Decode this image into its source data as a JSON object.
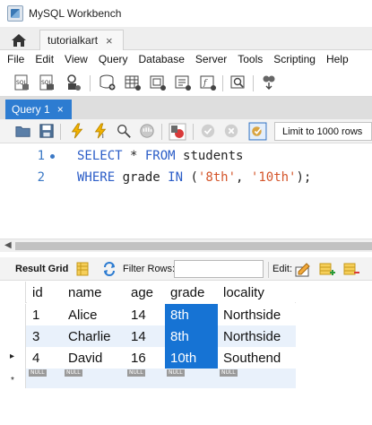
{
  "window": {
    "title": "MySQL Workbench"
  },
  "tabs": {
    "connection": "tutorialkart",
    "close_glyph": "×"
  },
  "menu": [
    "File",
    "Edit",
    "View",
    "Query",
    "Database",
    "Server",
    "Tools",
    "Scripting",
    "Help"
  ],
  "query_tab": {
    "label": "Query 1",
    "close_glyph": "×"
  },
  "sql_toolbar": {
    "limit": "Limit to 1000 rows"
  },
  "editor": {
    "lines": [
      {
        "no": "1",
        "tokens": [
          {
            "t": "kw",
            "v": "SELECT"
          },
          {
            "t": "plain",
            "v": " * "
          },
          {
            "t": "kw",
            "v": "FROM"
          },
          {
            "t": "plain",
            "v": " students"
          }
        ]
      },
      {
        "no": "2",
        "tokens": [
          {
            "t": "kw",
            "v": "WHERE"
          },
          {
            "t": "plain",
            "v": " grade "
          },
          {
            "t": "kw",
            "v": "IN"
          },
          {
            "t": "plain",
            "v": " ("
          },
          {
            "t": "str",
            "v": "'8th'"
          },
          {
            "t": "plain",
            "v": ", "
          },
          {
            "t": "str",
            "v": "'10th'"
          },
          {
            "t": "plain",
            "v": ");"
          }
        ]
      }
    ]
  },
  "result_toolbar": {
    "result_grid": "Result Grid",
    "filter_rows": "Filter Rows:",
    "edit": "Edit:"
  },
  "grid": {
    "columns": [
      "id",
      "name",
      "age",
      "grade",
      "locality"
    ],
    "rows": [
      [
        "1",
        "Alice",
        "14",
        "8th",
        "Northside"
      ],
      [
        "3",
        "Charlie",
        "14",
        "8th",
        "Northside"
      ],
      [
        "4",
        "David",
        "16",
        "10th",
        "Southend"
      ]
    ],
    "selected_column": "grade",
    "null_label": "NULL",
    "new_row_marker": "*",
    "current_row_marker": "▸"
  }
}
